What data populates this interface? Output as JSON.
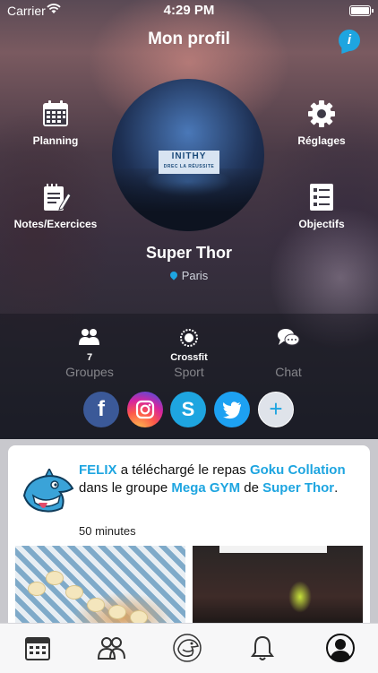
{
  "status_bar": {
    "carrier": "Carrier",
    "time": "4:29 PM"
  },
  "header": {
    "title": "Mon profil",
    "info_icon": "info-icon"
  },
  "menu": {
    "planning": "Planning",
    "settings": "Réglages",
    "notes": "Notes/Exercices",
    "goals": "Objectifs"
  },
  "profile": {
    "avatar_sign": "INITHY",
    "avatar_sign_sub": "DREC LA RÉUSSITE",
    "name": "Super Thor",
    "city": "Paris"
  },
  "stats": [
    {
      "icon": "groups-icon",
      "value": "7",
      "label": "Groupes"
    },
    {
      "icon": "sport-icon",
      "value": "Crossfit",
      "label": "Sport"
    },
    {
      "icon": "chat-icon",
      "value": "",
      "label": "Chat"
    }
  ],
  "socials": {
    "facebook": "f",
    "skype": "S",
    "add": "+"
  },
  "feed": {
    "user": "FELIX",
    "action": "a téléchargé le repas",
    "meal": "Goku Collation",
    "in_group": "dans le groupe",
    "group": "Mega GYM",
    "of": "de",
    "owner": "Super Thor",
    "end": ".",
    "time": "50 minutes"
  },
  "tabbar": [
    "calendar-icon",
    "groups-icon",
    "team-logo-icon",
    "bell-icon",
    "profile-icon"
  ],
  "colors": {
    "accent": "#1ea5e0",
    "facebook": "#3b5998",
    "twitter": "#1da1f2"
  }
}
